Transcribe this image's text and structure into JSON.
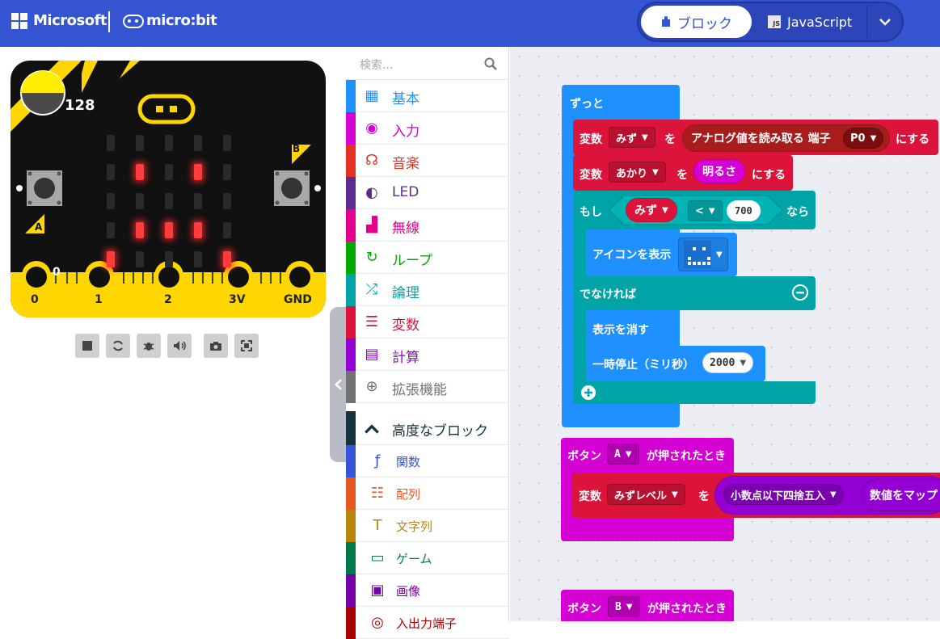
{
  "header": {
    "brand_microsoft": "Microsoft",
    "brand_microbit": "micro:bit",
    "tab_blocks": "ブロック",
    "tab_javascript": "JavaScript",
    "js_badge": "JS",
    "colors": {
      "header": "#3454d1"
    }
  },
  "simulator": {
    "light_level": "128",
    "pin_value": "0",
    "button_a": "A",
    "button_b": "B",
    "pins": [
      "0",
      "1",
      "2",
      "3V",
      "GND"
    ],
    "led_on": [
      [
        1,
        1
      ],
      [
        1,
        3
      ],
      [
        3,
        1
      ],
      [
        3,
        2
      ],
      [
        3,
        3
      ],
      [
        4,
        0
      ],
      [
        4,
        4
      ]
    ],
    "toolbar_icons": [
      "stop-icon",
      "restart-icon",
      "debug-icon",
      "sound-icon",
      "screenshot-icon",
      "fullscreen-icon"
    ]
  },
  "toolbox": {
    "search_placeholder": "検索...",
    "categories": [
      {
        "label": "基本",
        "color": "#1e90ff",
        "icon": "grid-icon"
      },
      {
        "label": "入力",
        "color": "#d400d4",
        "icon": "target-icon"
      },
      {
        "label": "音楽",
        "color": "#e63022",
        "icon": "headphones-icon"
      },
      {
        "label": "LED",
        "color": "#5c2d91",
        "icon": "toggle-icon"
      },
      {
        "label": "無線",
        "color": "#e3008c",
        "icon": "signal-icon"
      },
      {
        "label": "ループ",
        "color": "#00aa00",
        "icon": "loop-icon"
      },
      {
        "label": "論理",
        "color": "#00a4a6",
        "icon": "shuffle-icon"
      },
      {
        "label": "変数",
        "color": "#dc143c",
        "icon": "list-icon"
      },
      {
        "label": "計算",
        "color": "#9400d3",
        "icon": "calculator-icon"
      },
      {
        "label": "拡張機能",
        "color": "#717171",
        "icon": "plus-circle-icon"
      }
    ],
    "advanced_label": "高度なブロック",
    "advanced": [
      {
        "label": "関数",
        "color": "#3455db",
        "icon": "function-icon"
      },
      {
        "label": "配列",
        "color": "#e65722",
        "icon": "array-icon"
      },
      {
        "label": "文字列",
        "color": "#b8860b",
        "icon": "text-icon"
      },
      {
        "label": "ゲーム",
        "color": "#007a4b",
        "icon": "gamepad-icon"
      },
      {
        "label": "画像",
        "color": "#7600a8",
        "icon": "image-icon"
      },
      {
        "label": "入出力端子",
        "color": "#a80000",
        "icon": "pin-icon"
      }
    ]
  },
  "workspace": {
    "forever": "ずっと",
    "set1": {
      "kw": "変数",
      "var": "みず",
      "to": "を",
      "func": "アナログ値を読み取る 端子",
      "pin": "P0",
      "suffix": "にする"
    },
    "set2": {
      "kw": "変数",
      "var": "あかり",
      "to": "を",
      "func": "明るさ",
      "suffix": "にする"
    },
    "if": {
      "kw": "もし",
      "var": "みず",
      "op": "<",
      "value": "700",
      "then": "なら"
    },
    "show_icon": "アイコンを表示",
    "else": "でなければ",
    "clear": "表示を消す",
    "pause": "一時停止（ミリ秒）",
    "pause_value": "2000",
    "onA": {
      "prefix": "ボタン",
      "button": "A",
      "suffix": "が押されたとき"
    },
    "setA": {
      "kw": "変数",
      "var": "みずレベル",
      "to": "を",
      "round": "小数点以下四捨五入",
      "map": "数値をマップ"
    },
    "onB": {
      "prefix": "ボタン",
      "button": "B",
      "suffix": "が押されたとき"
    }
  }
}
